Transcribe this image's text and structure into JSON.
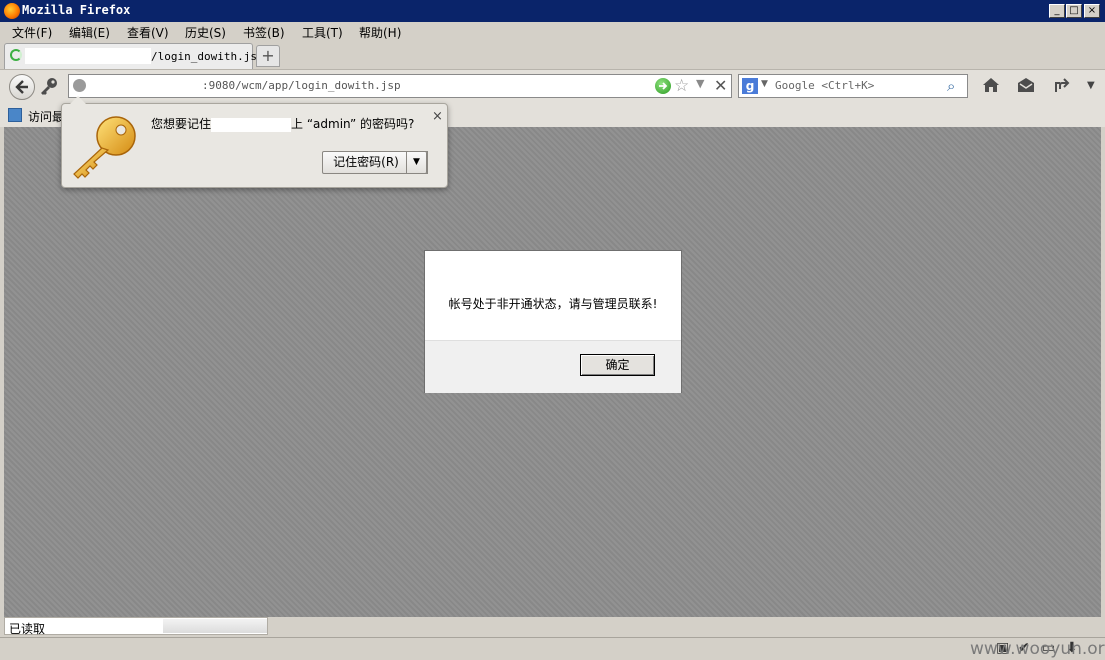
{
  "window": {
    "title": "Mozilla Firefox",
    "controls": [
      "_",
      "□",
      "×"
    ]
  },
  "menubar": {
    "items": [
      "文件(F)",
      "编辑(E)",
      "查看(V)",
      "历史(S)",
      "书签(B)",
      "工具(T)",
      "帮助(H)"
    ]
  },
  "tab": {
    "title": "/login_dowith.jsp",
    "new_tab_label": "+"
  },
  "navbar": {
    "url": ":9080/wcm/app/login_dowith.jsp",
    "search_engine_letter": "g",
    "search_placeholder": "Google <Ctrl+K>",
    "icons": {
      "back": "back-arrow-icon",
      "identity": "key-icon",
      "go": "go-arrow-icon",
      "star": "star-icon",
      "stop": "stop-icon",
      "home": "home-icon",
      "mail": "mail-icon",
      "share": "share-icon"
    }
  },
  "bookmarks": {
    "label": "访问最"
  },
  "password_prompt": {
    "message_before": "您想要记住",
    "message_after": "上 “admin” 的密码吗?",
    "remember_button": "记住密码(R)",
    "close_label": "×"
  },
  "alert": {
    "message": "帐号处于非开通状态，请与管理员联系!",
    "ok_label": "确定"
  },
  "status": {
    "text": "已读取"
  },
  "watermark": "www.wooyun.org",
  "colors": {
    "titlebar": "#0a246a",
    "content_bg": "#8e8e8e",
    "chrome": "#d4d0c8"
  }
}
